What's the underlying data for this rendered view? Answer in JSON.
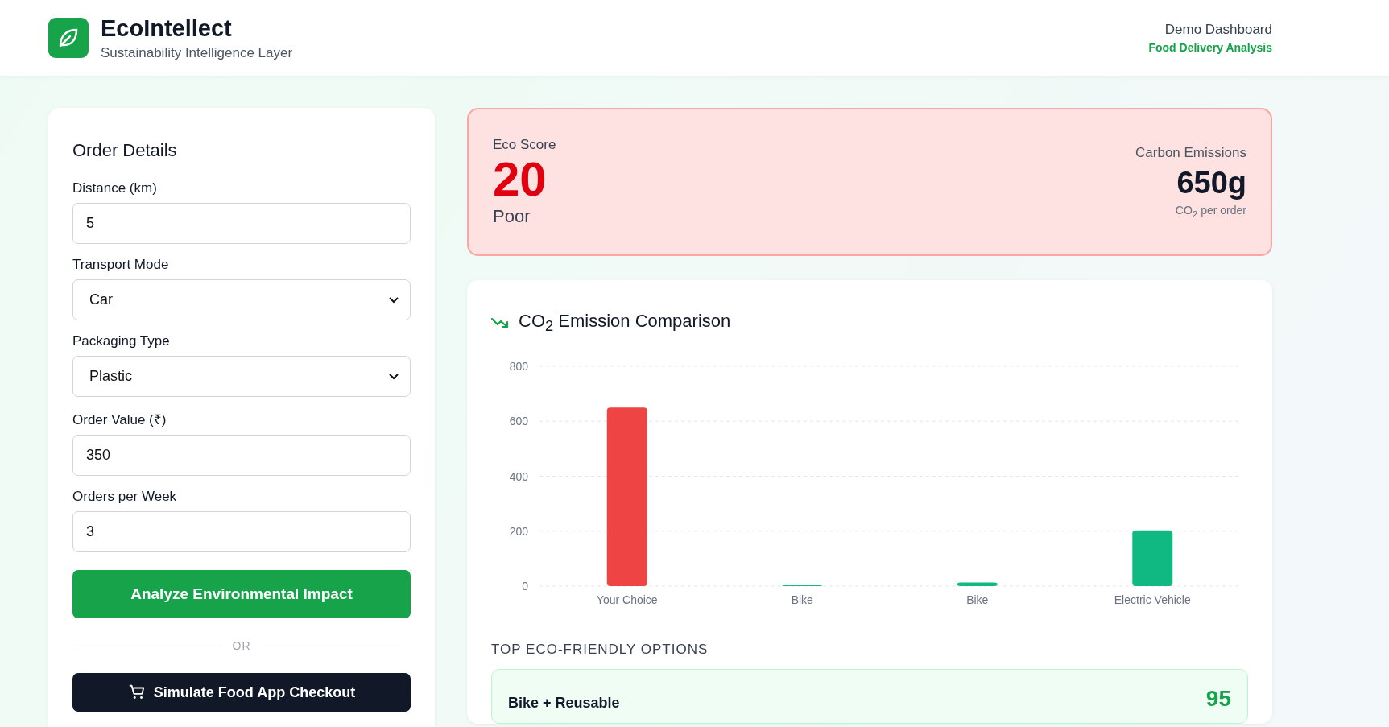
{
  "header": {
    "title": "EcoIntellect",
    "subtitle": "Sustainability Intelligence Layer",
    "context": "Demo Dashboard",
    "context_sub": "Food Delivery Analysis"
  },
  "order_form": {
    "title": "Order Details",
    "fields": [
      {
        "kind": "input",
        "label": "Distance (km)",
        "value": "5"
      },
      {
        "kind": "select",
        "label": "Transport Mode",
        "value": "Car"
      },
      {
        "kind": "select",
        "label": "Packaging Type",
        "value": "Plastic"
      },
      {
        "kind": "input",
        "label": "Order Value (₹)",
        "value": "350"
      },
      {
        "kind": "input",
        "label": "Orders per Week",
        "value": "3"
      }
    ],
    "analyze_button": "Analyze Environmental Impact",
    "divider": "OR",
    "checkout_button": "Simulate Food App Checkout"
  },
  "eco_score": {
    "label": "Eco Score",
    "score": "20",
    "rating": "Poor",
    "emissions_label": "Carbon Emissions",
    "emissions": "650g",
    "emissions_unit": "CO$_{2}$ per order"
  },
  "comparison": {
    "title": "CO$_{2}$ Emission Comparison",
    "chart_data": {
      "type": "bar",
      "categories": [
        "Your Choice",
        "Bike",
        "Bike",
        "Electric Vehicle"
      ],
      "values": [
        650,
        3,
        13,
        203
      ],
      "ylim": [
        0,
        800
      ],
      "yticks": [
        0,
        200,
        400,
        600,
        800
      ],
      "grid": true
    },
    "options_heading": "TOP ECO-FRIENDLY OPTIONS",
    "options": [
      {
        "name": "Bike + Reusable",
        "score": "95"
      }
    ]
  }
}
